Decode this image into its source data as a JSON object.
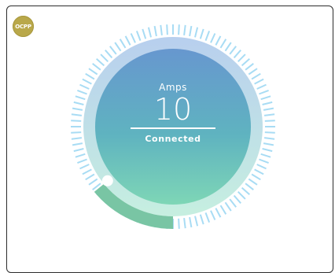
{
  "badge": {
    "text": "OCPP"
  },
  "gauge": {
    "label": "Amps",
    "value": "10",
    "status": "Connected",
    "fill_fraction": 0.14,
    "colors": {
      "inner_top": "#6a9bd0",
      "inner_bottom": "#7ed3b8",
      "ring_top": "#c5d8f0",
      "ring_bottom": "#c8eee0",
      "tick": "#a8dcf4",
      "progress": "#79c5a4"
    }
  }
}
